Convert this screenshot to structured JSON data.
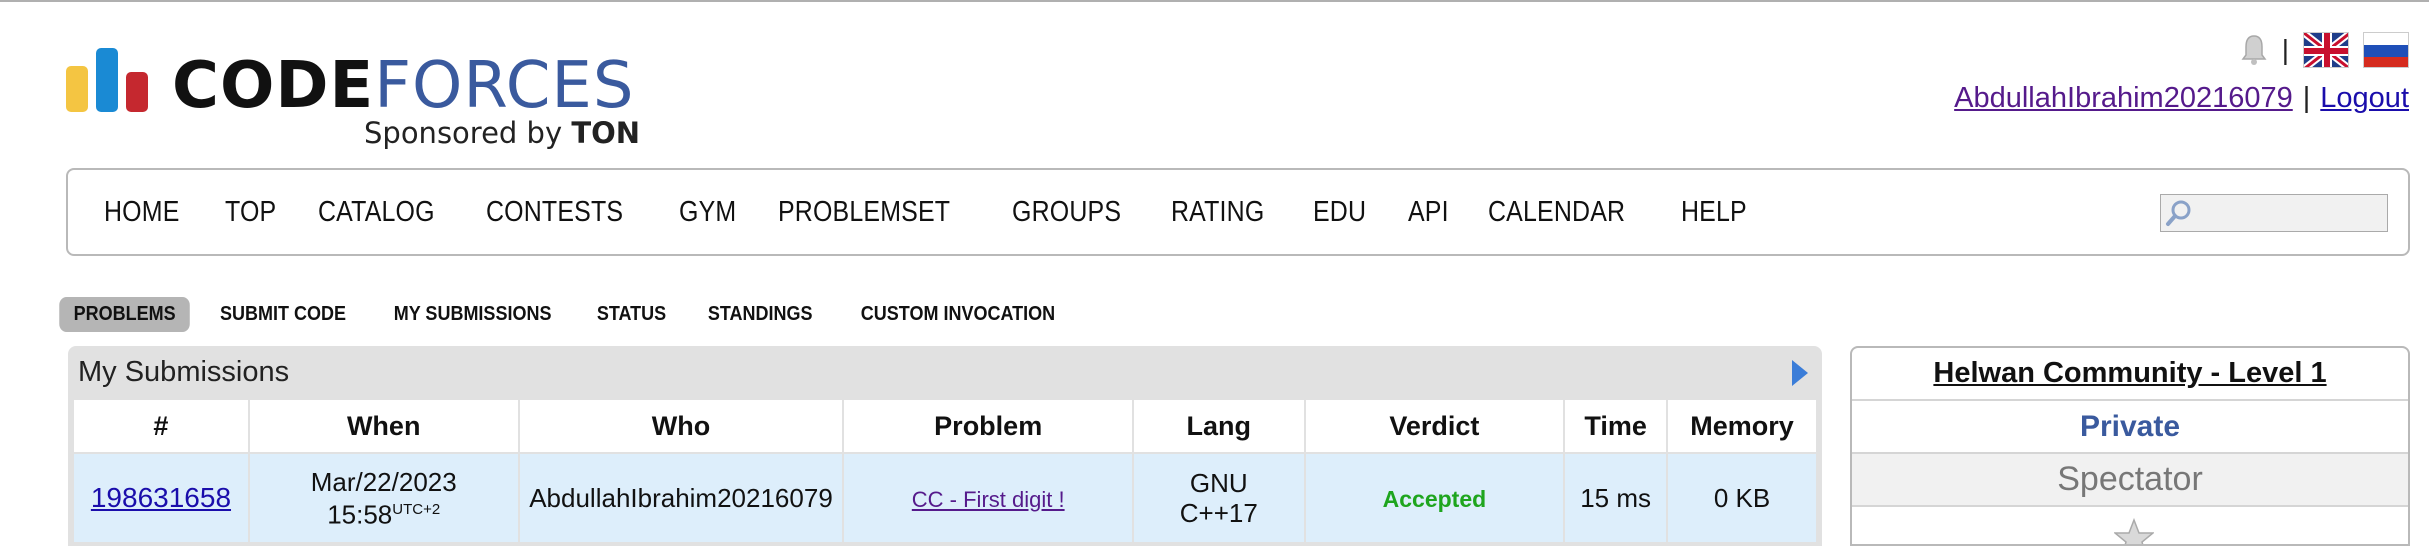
{
  "logo": {
    "word_code": "CODE",
    "word_forces": "FORCES",
    "sponsor_prefix": "Sponsored by ",
    "sponsor_name": "TON"
  },
  "header": {
    "separator": "|",
    "username": "AbdullahIbrahim20216079",
    "pipe": "|",
    "logout": "Logout",
    "icons": [
      "bell-icon",
      "uk-flag-icon",
      "russia-flag-icon"
    ]
  },
  "nav": {
    "items": [
      "HOME",
      "TOP",
      "CATALOG",
      "CONTESTS",
      "GYM",
      "PROBLEMSET",
      "GROUPS",
      "RATING",
      "EDU",
      "API",
      "CALENDAR",
      "HELP"
    ],
    "search_placeholder": ""
  },
  "subnav": {
    "items": [
      "PROBLEMS",
      "SUBMIT CODE",
      "MY SUBMISSIONS",
      "STATUS",
      "STANDINGS",
      "CUSTOM INVOCATION"
    ],
    "active": "PROBLEMS"
  },
  "submissions": {
    "title": "My Submissions",
    "columns": [
      "#",
      "When",
      "Who",
      "Problem",
      "Lang",
      "Verdict",
      "Time",
      "Memory"
    ],
    "rows": [
      {
        "id": "198631658",
        "when_date": "Mar/22/2023",
        "when_time": "15:58",
        "when_tz": "UTC+2",
        "who": "AbdullahIbrahim20216079",
        "problem": "CC - First digit !",
        "lang_line1": "GNU",
        "lang_line2": "C++17",
        "verdict": "Accepted",
        "time": "15 ms",
        "memory": "0 KB"
      }
    ]
  },
  "sidebar": {
    "group_title": "Helwan Community - Level 1",
    "visibility": "Private",
    "role": "Spectator"
  },
  "colors": {
    "accent_blue": "#3a5a9e",
    "accepted_green": "#1ea51e",
    "row_highlight": "#ddeefb"
  }
}
